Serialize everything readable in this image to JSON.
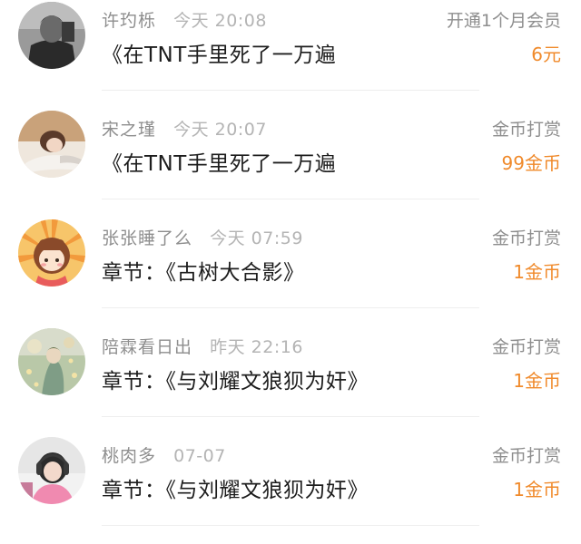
{
  "records": [
    {
      "username": "许玓栎",
      "time": "今天 20:08",
      "title": "《在TNT手里死了一万遍",
      "type": "开通1个月会员",
      "amount": "6元",
      "avatar": "avatar-bw-portrait"
    },
    {
      "username": "宋之瑾",
      "time": "今天 20:07",
      "title": "《在TNT手里死了一万遍",
      "type": "金币打赏",
      "amount": "99金币",
      "avatar": "avatar-person-lying"
    },
    {
      "username": "张张睡了么",
      "time": "今天 07:59",
      "title": "章节：《古树大合影》",
      "type": "金币打赏",
      "amount": "1金币",
      "avatar": "avatar-cartoon-girl"
    },
    {
      "username": "陪霖看日出",
      "time": "昨天 22:16",
      "title": "章节：《与刘耀文狼狈为奸》",
      "type": "金币打赏",
      "amount": "1金币",
      "avatar": "avatar-floral-illustration"
    },
    {
      "username": "桃肉多",
      "time": "07-07",
      "title": "章节：《与刘耀文狼狈为奸》",
      "type": "金币打赏",
      "amount": "1金币",
      "avatar": "avatar-headphones-girl"
    }
  ],
  "colors": {
    "accent": "#f08a2b",
    "username": "#8e8e8e",
    "time": "#b4b4b4",
    "title": "#1d1d1d"
  }
}
